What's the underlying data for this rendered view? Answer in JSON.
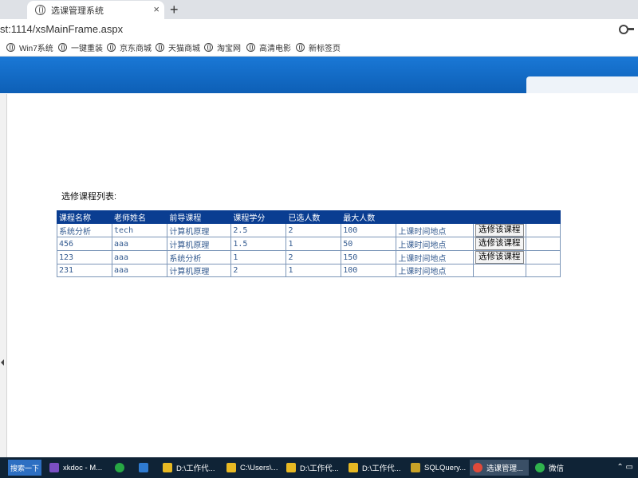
{
  "browser": {
    "tab_title": "选课管理系统",
    "url": "st:1114/xsMainFrame.aspx",
    "bookmarks": [
      "Win7系统",
      "一键重装",
      "京东商城",
      "天猫商城",
      "淘宝网",
      "高清电影",
      "新标签页"
    ]
  },
  "page": {
    "list_title": "选修课程列表:",
    "headers": [
      "课程名称",
      "老师姓名",
      "前导课程",
      "课程学分",
      "已选人数",
      "最大人数",
      "",
      "",
      ""
    ],
    "rows": [
      {
        "course": "系统分析",
        "teacher": "tech",
        "prereq": "计算机原理",
        "credit": "2.5",
        "selected": "2",
        "max": "100",
        "link": "上课时间地点",
        "action": "选修该课程"
      },
      {
        "course": "456",
        "teacher": "aaa",
        "prereq": "计算机原理",
        "credit": "1.5",
        "selected": "1",
        "max": "50",
        "link": "上课时间地点",
        "action": "选修该课程"
      },
      {
        "course": "123",
        "teacher": "aaa",
        "prereq": "系统分析",
        "credit": "1",
        "selected": "2",
        "max": "150",
        "link": "上课时间地点",
        "action": "选修该课程"
      },
      {
        "course": "231",
        "teacher": "aaa",
        "prereq": "计算机原理",
        "credit": "2",
        "selected": "1",
        "max": "100",
        "link": "上课时间地点",
        "action": ""
      }
    ]
  },
  "taskbar": {
    "search_label": "搜索一下",
    "items": [
      "xkdoc - M...",
      "",
      "",
      "D:\\工作代...",
      "C:\\Users\\...",
      "D:\\工作代...",
      "D:\\工作代...",
      "SQLQuery...",
      "选课管理...",
      "微信"
    ],
    "colors": {
      "header": "#0a3d91",
      "band": "#1a78d6",
      "taskbar": "#0f2336"
    }
  }
}
